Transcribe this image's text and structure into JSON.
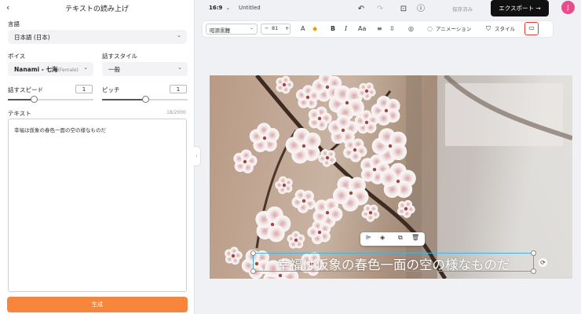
{
  "panel": {
    "back_icon": "chevron-left-icon",
    "title": "テキストの読み上げ",
    "language_label": "言語",
    "language_value": "日本語 (日本)",
    "voice_label": "ボイス",
    "voice_name": "Nanami - 七海",
    "voice_gender": "(Female)",
    "style_label": "話すスタイル",
    "style_value": "一般",
    "speed_label": "話すスピード",
    "speed_value": "1",
    "speed_level": 0.3,
    "pitch_label": "ピッチ",
    "pitch_value": "1",
    "pitch_level": 0.5,
    "text_label": "テキスト",
    "char_count": "18/2000",
    "text_value": "幸福は仮象の春色一面の空の様なものだ",
    "generate_label": "生成",
    "accent_color": "#f7853b"
  },
  "topbar": {
    "ratio": "16:9",
    "doc_title": "Untitled",
    "saved_label": "保存済み",
    "export_label": "エクスポート →",
    "avatar_initial": "J",
    "avatar_color": "#ea4c89"
  },
  "format": {
    "font_name": "昭源黒體",
    "font_size": "81",
    "minus": "−",
    "plus": "+",
    "case_label": "Aa",
    "bold_label": "B",
    "italic_label": "I",
    "text_color_label": "A",
    "animation_label": "アニメーション",
    "style_label": "スタイル"
  },
  "canvas": {
    "caption": "幸福は仮象の春色一面の空の様なものだ",
    "selection_color": "#3fb3e6"
  }
}
